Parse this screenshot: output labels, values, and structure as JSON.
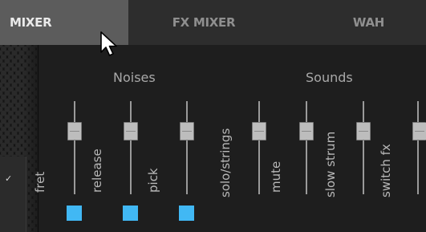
{
  "tabs": [
    {
      "label": "MIXER",
      "active": true
    },
    {
      "label": "FX MIXER",
      "active": false
    },
    {
      "label": "WAH",
      "active": false
    }
  ],
  "sections": {
    "noises": "Noises",
    "sounds": "Sounds"
  },
  "channels": [
    {
      "label": "fret",
      "group": "noises",
      "indicator": true
    },
    {
      "label": "release",
      "group": "noises",
      "indicator": true
    },
    {
      "label": "pick",
      "group": "noises",
      "indicator": true
    },
    {
      "label": "solo/strings",
      "group": "sounds",
      "indicator": false
    },
    {
      "label": "mute",
      "group": "sounds",
      "indicator": false
    },
    {
      "label": "slow strum",
      "group": "sounds",
      "indicator": false
    },
    {
      "label": "switch fx",
      "group": "sounds",
      "indicator": false
    }
  ],
  "side_panel": {
    "check_glyph": "✓"
  },
  "colors": {
    "indicator": "#41b8f4",
    "active_tab": "#5c5c5c",
    "tab_bar": "#2d2d2d"
  }
}
